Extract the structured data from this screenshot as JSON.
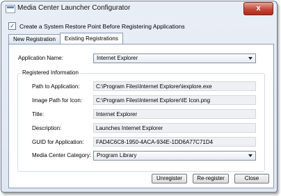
{
  "window": {
    "title": "Media Center Launcher Configurator",
    "close_label": "x"
  },
  "restore_point": {
    "label": "Create a System Restore Point Before Registering Applications",
    "checked": true,
    "check_glyph": "✓"
  },
  "tabs": [
    {
      "label": "New Registration",
      "active": false
    },
    {
      "label": "Existing Registrations",
      "active": true
    }
  ],
  "app_name": {
    "label": "Application Name:",
    "value": "Internet Explorer"
  },
  "registered": {
    "title": "Registered Information",
    "path_label": "Path to Application:",
    "path_value": "C:\\Program Files\\Internet Explorer\\iexplore.exe",
    "image_label": "Image Path for Icon:",
    "image_value": "C:\\Program Files\\Internet Explorer\\IE Icon.png",
    "title_label": "Title:",
    "title_value": "Internet Explorer",
    "desc_label": "Description:",
    "desc_value": "Launches Internet Explorer",
    "guid_label": "GUID for Application:",
    "guid_value": "FAD4C6C8-1950-4ACA-934E-1DD6A77C71D4",
    "category_label": "Media Center Category:",
    "category_value": "Program Library"
  },
  "buttons": {
    "unregister": "Unregister",
    "reregister": "Re-register",
    "close": "Close"
  }
}
